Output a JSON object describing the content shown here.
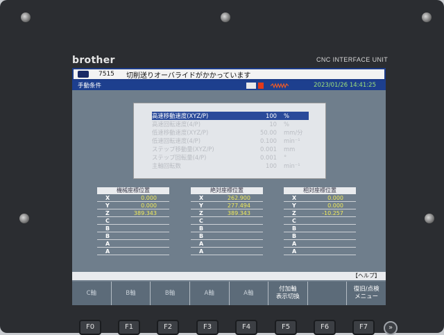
{
  "brand": "brother",
  "unit_label": "CNC INTERFACE UNIT",
  "message": {
    "code": "7515",
    "text": "切削送りオーバライドがかかっています"
  },
  "status": {
    "mode_title": "手動条件",
    "datetime": "2023/01/26 14:41:25"
  },
  "params": [
    {
      "label": "高速移動速度(XYZ/P)",
      "value": "100",
      "unit": "%"
    },
    {
      "label": "高速回転速度(4/P)",
      "value": "10",
      "unit": "%"
    },
    {
      "label": "低速移動速度(XYZ/P)",
      "value": "50.00",
      "unit": "mm/分"
    },
    {
      "label": "低速回転速度(4/P)",
      "value": "0.100",
      "unit": "min⁻¹"
    },
    {
      "label": "ステップ移動量(XYZ/P)",
      "value": "0.001",
      "unit": "mm"
    },
    {
      "label": "ステップ回転量(4/P)",
      "value": "0.001",
      "unit": "°"
    },
    {
      "label": "主軸回転数",
      "value": "100",
      "unit": "min⁻¹"
    }
  ],
  "coords": [
    {
      "title": "機械座標位置",
      "rows": [
        {
          "axis": "X",
          "value": "0.000"
        },
        {
          "axis": "Y",
          "value": "0.000"
        },
        {
          "axis": "Z",
          "value": "389.343"
        },
        {
          "axis": "C",
          "value": ""
        },
        {
          "axis": "B",
          "value": ""
        },
        {
          "axis": "B",
          "value": ""
        },
        {
          "axis": "A",
          "value": ""
        },
        {
          "axis": "A",
          "value": ""
        }
      ]
    },
    {
      "title": "絶対座標位置",
      "rows": [
        {
          "axis": "X",
          "value": "262.900"
        },
        {
          "axis": "Y",
          "value": "277.494"
        },
        {
          "axis": "Z",
          "value": "389.343"
        },
        {
          "axis": "C",
          "value": ""
        },
        {
          "axis": "B",
          "value": ""
        },
        {
          "axis": "B",
          "value": ""
        },
        {
          "axis": "A",
          "value": ""
        },
        {
          "axis": "A",
          "value": ""
        }
      ]
    },
    {
      "title": "相対座標位置",
      "rows": [
        {
          "axis": "X",
          "value": "0.000"
        },
        {
          "axis": "Y",
          "value": "0.000"
        },
        {
          "axis": "Z",
          "value": "-10.257"
        },
        {
          "axis": "C",
          "value": ""
        },
        {
          "axis": "B",
          "value": ""
        },
        {
          "axis": "B",
          "value": ""
        },
        {
          "axis": "A",
          "value": ""
        },
        {
          "axis": "A",
          "value": ""
        }
      ]
    }
  ],
  "help_label": "【ヘルプ】",
  "softkeys": [
    "C軸",
    "B軸",
    "B軸",
    "A軸",
    "A軸",
    "付加軸\n表示切換",
    "",
    "復旧/点検\nメニュー"
  ],
  "hardkeys": [
    "F0",
    "F1",
    "F2",
    "F3",
    "F4",
    "F5",
    "F6",
    "F7"
  ],
  "next_key": "»"
}
